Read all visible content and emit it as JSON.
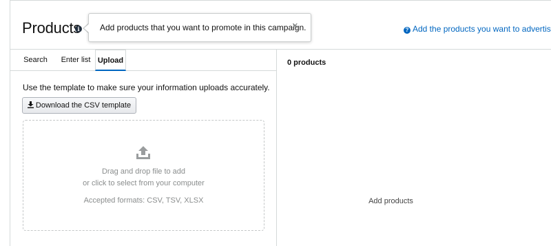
{
  "header": {
    "title": "Products",
    "info_icon": "i",
    "help_icon": "?",
    "help_link": "Add the products you want to advertise"
  },
  "tooltip": {
    "text": "Add products that you want to promote in this campaign.",
    "close_icon": "×"
  },
  "tabs": [
    {
      "label": "Search",
      "active": false
    },
    {
      "label": "Enter list",
      "active": false
    },
    {
      "label": "Upload",
      "active": true
    }
  ],
  "upload": {
    "instructions": "Use the template to make sure your information uploads accurately.",
    "download_button": "Download the CSV template",
    "drop_line1": "Drag and drop file to add",
    "drop_line2": "or click to select from your computer",
    "formats": "Accepted formats: CSV, TSV, XLSX"
  },
  "selected": {
    "count": "0 products",
    "empty_message": "Add products"
  },
  "colors": {
    "link": "#0066c0",
    "border": "#d5d9d9",
    "muted": "#8a8d8d"
  }
}
